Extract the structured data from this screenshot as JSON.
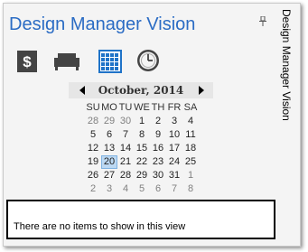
{
  "app": {
    "title": "Design Manager Vision",
    "side_title": "Design Manager Vision"
  },
  "toolbar": {
    "icons": [
      "dollar-icon",
      "sofa-icon",
      "calendar-icon",
      "clock-icon"
    ],
    "active": "calendar-icon"
  },
  "calendar": {
    "month_label": "October, 2014",
    "weekdays": [
      "SU",
      "MO",
      "TU",
      "WE",
      "TH",
      "FR",
      "SA"
    ],
    "selected_day": "20",
    "weeks": [
      [
        {
          "d": "28",
          "o": true
        },
        {
          "d": "29",
          "o": true
        },
        {
          "d": "30",
          "o": true
        },
        {
          "d": "1",
          "o": false
        },
        {
          "d": "2",
          "o": false
        },
        {
          "d": "3",
          "o": false
        },
        {
          "d": "4",
          "o": false
        }
      ],
      [
        {
          "d": "5",
          "o": false
        },
        {
          "d": "6",
          "o": false
        },
        {
          "d": "7",
          "o": false
        },
        {
          "d": "8",
          "o": false
        },
        {
          "d": "9",
          "o": false
        },
        {
          "d": "10",
          "o": false
        },
        {
          "d": "11",
          "o": false
        }
      ],
      [
        {
          "d": "12",
          "o": false
        },
        {
          "d": "13",
          "o": false
        },
        {
          "d": "14",
          "o": false
        },
        {
          "d": "15",
          "o": false
        },
        {
          "d": "16",
          "o": false
        },
        {
          "d": "17",
          "o": false
        },
        {
          "d": "18",
          "o": false
        }
      ],
      [
        {
          "d": "19",
          "o": false
        },
        {
          "d": "20",
          "o": false
        },
        {
          "d": "21",
          "o": false
        },
        {
          "d": "22",
          "o": false
        },
        {
          "d": "23",
          "o": false
        },
        {
          "d": "24",
          "o": false
        },
        {
          "d": "25",
          "o": false
        }
      ],
      [
        {
          "d": "26",
          "o": false
        },
        {
          "d": "27",
          "o": false
        },
        {
          "d": "28",
          "o": false
        },
        {
          "d": "29",
          "o": false
        },
        {
          "d": "30",
          "o": false
        },
        {
          "d": "31",
          "o": false
        },
        {
          "d": "1",
          "o": true
        }
      ],
      [
        {
          "d": "2",
          "o": true
        },
        {
          "d": "3",
          "o": true
        },
        {
          "d": "4",
          "o": true
        },
        {
          "d": "5",
          "o": true
        },
        {
          "d": "6",
          "o": true
        },
        {
          "d": "7",
          "o": true
        },
        {
          "d": "8",
          "o": true
        }
      ]
    ]
  },
  "items_view": {
    "empty_message": "There are no items to show in this view"
  },
  "colors": {
    "title": "#2b6cc4",
    "icon_fill": "#444444",
    "calendar_icon": "#1f73c8",
    "selected_day_bg": "#bcd8f2"
  }
}
